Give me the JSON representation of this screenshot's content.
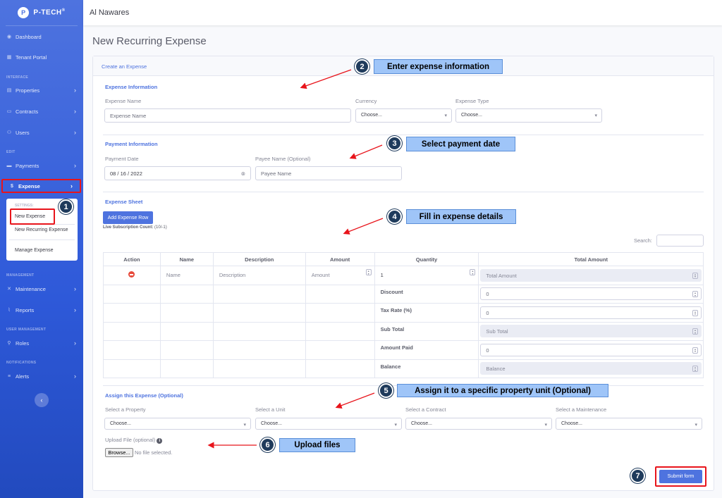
{
  "brand": {
    "logo_letter": "P",
    "name": "P-TECH",
    "mark": "®"
  },
  "topbar": {
    "company": "Al Nawares"
  },
  "sidebar": {
    "items": [
      {
        "label": "Dashboard"
      },
      {
        "label": "Tenant Portal"
      },
      {
        "label": "Properties"
      },
      {
        "label": "Contracts"
      },
      {
        "label": "Users"
      },
      {
        "label": "Payments"
      },
      {
        "label": "Expense"
      },
      {
        "label": "Maintenance"
      },
      {
        "label": "Reports"
      },
      {
        "label": "Roles"
      },
      {
        "label": "Alerts"
      }
    ],
    "headings": [
      "INTERFACE",
      "EDIT",
      "MANAGEMENT",
      "USER MANAGEMENT",
      "NOTIFICATIONS"
    ],
    "submenu": {
      "heading": "SETTINGS:",
      "items": [
        "New Expense",
        "New Recurring Expense",
        "Manage Expense"
      ]
    },
    "toggle_icon": "‹"
  },
  "page": {
    "title": "New Recurring Expense"
  },
  "card": {
    "header": "Create an Expense"
  },
  "expense_info": {
    "title": "Expense Information",
    "name_label": "Expense Name",
    "name_placeholder": "Expense Name",
    "currency_label": "Currency",
    "currency_value": "Choose...",
    "type_label": "Expense Type",
    "type_value": "Choose..."
  },
  "payment_info": {
    "title": "Payment Information",
    "date_label": "Payment Date",
    "date_value": "08 / 16 / 2022",
    "payee_label": "Payee Name (Optional)",
    "payee_placeholder": "Payee Name"
  },
  "sheet": {
    "title": "Expense Sheet",
    "add_row": "Add Expense Row",
    "subscription_label": "Live Subscription Count:",
    "subscription_value": "(10/-1)",
    "search_label": "Search:",
    "columns": [
      "Action",
      "Name",
      "Description",
      "Amount",
      "Quantity",
      "Total Amount"
    ],
    "row": {
      "name": "Name",
      "description": "Description",
      "amount": "Amount",
      "quantity": "1",
      "total": "Total Amount"
    },
    "summary": [
      {
        "label": "Discount",
        "value": "0"
      },
      {
        "label": "Tax Rate (%)",
        "value": "0"
      },
      {
        "label": "Sub Total",
        "value": "Sub Total"
      },
      {
        "label": "Amount Paid",
        "value": "0"
      },
      {
        "label": "Balance",
        "value": "Balance"
      }
    ]
  },
  "assign": {
    "title": "Assign this Expense (Optional)",
    "property_label": "Select a Property",
    "unit_label": "Select a Unit",
    "contract_label": "Select a Contract",
    "maintenance_label": "Select a Maintenance",
    "choose": "Choose..."
  },
  "upload": {
    "label": "Upload File (optional)",
    "button": "Browse...",
    "status": "No file selected."
  },
  "submit": "Submit form",
  "callouts": [
    {
      "num": "1"
    },
    {
      "num": "2",
      "text": "Enter expense information"
    },
    {
      "num": "3",
      "text": "Select payment date"
    },
    {
      "num": "4",
      "text": "Fill in expense details"
    },
    {
      "num": "5",
      "text": "Assign it to a specific property unit (Optional)"
    },
    {
      "num": "6",
      "text": "Upload files"
    },
    {
      "num": "7"
    }
  ],
  "colors": {
    "primary": "#4e73df",
    "highlight": "#e8141b",
    "callout_bg": "#9fc5f8",
    "badge": "#1f3b5c",
    "danger": "#e74a3b"
  }
}
